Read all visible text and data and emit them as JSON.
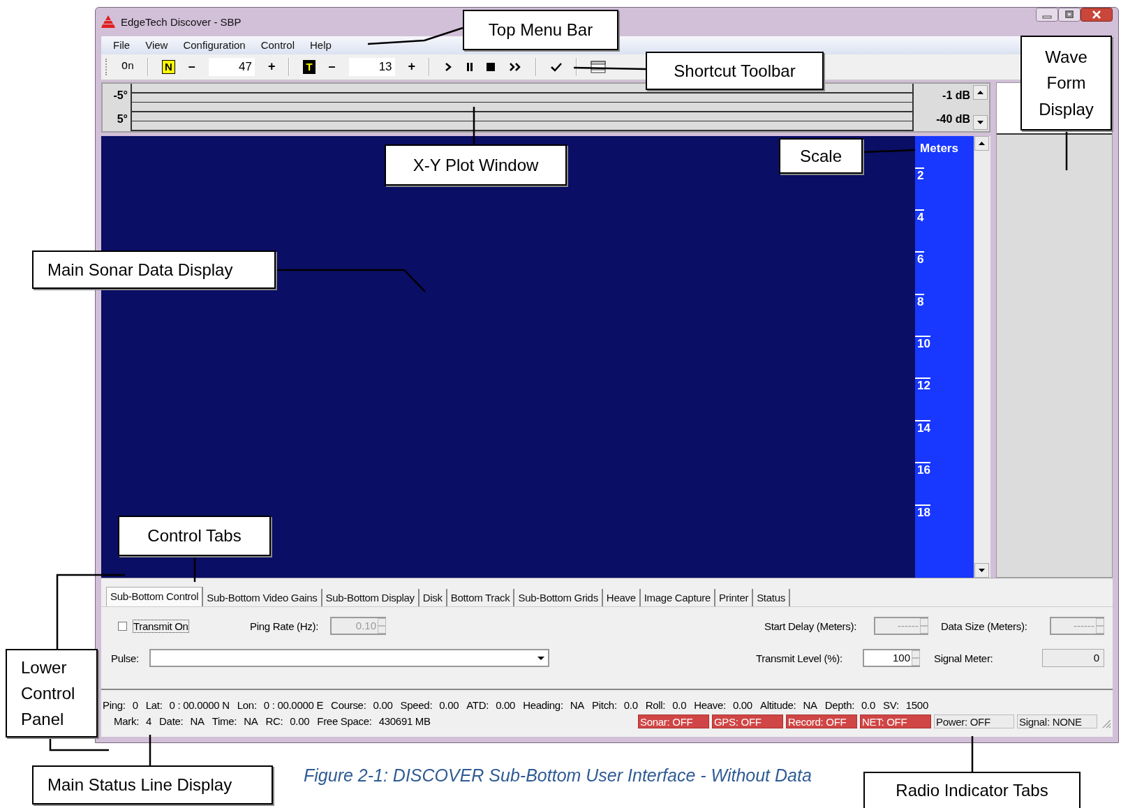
{
  "window": {
    "title": "EdgeTech  Discover - SBP"
  },
  "menu": [
    "File",
    "View",
    "Configuration",
    "Control",
    "Help"
  ],
  "toolbar": {
    "mode": "On",
    "gain_groups": [
      {
        "badge": "N",
        "inverted": false,
        "minus": "–",
        "value": "47",
        "plus": "+"
      },
      {
        "badge": "T",
        "inverted": true,
        "minus": "–",
        "value": "13",
        "plus": "+"
      }
    ]
  },
  "angle_scale": {
    "top": "-5°",
    "bottom": "5°"
  },
  "db_scale": {
    "top": "-1 dB",
    "bottom": "-40 dB"
  },
  "depth_scale": {
    "unit": "Meters",
    "ticks": [
      "2",
      "4",
      "6",
      "8",
      "10",
      "12",
      "14",
      "16",
      "18"
    ]
  },
  "tabs": [
    {
      "label": "Sub-Bottom Control",
      "selected": true
    },
    {
      "label": "Sub-Bottom Video Gains",
      "selected": false
    },
    {
      "label": "Sub-Bottom Display",
      "selected": false
    },
    {
      "label": "Disk",
      "selected": false
    },
    {
      "label": "Bottom Track",
      "selected": false
    },
    {
      "label": "Sub-Bottom Grids",
      "selected": false
    },
    {
      "label": "Heave",
      "selected": false
    },
    {
      "label": "Image Capture",
      "selected": false
    },
    {
      "label": "Printer",
      "selected": false
    },
    {
      "label": "Status",
      "selected": false
    }
  ],
  "controls": {
    "transmit": {
      "label": "Transmit On",
      "checked": false
    },
    "ping_rate": {
      "label": "Ping Rate (Hz):",
      "value": "0.10",
      "disabled": true
    },
    "start_delay": {
      "label": "Start Delay (Meters):",
      "value": "------",
      "disabled": true
    },
    "data_size": {
      "label": "Data Size (Meters):",
      "value": "------",
      "disabled": true
    },
    "pulse": {
      "label": "Pulse:"
    },
    "transmit_level": {
      "label": "Transmit Level (%):",
      "value": "100",
      "disabled": false
    },
    "signal_meter": {
      "label": "Signal Meter:",
      "value": "0"
    }
  },
  "status_line_1": [
    {
      "label": "Ping:",
      "value": "0"
    },
    {
      "label": "Lat:",
      "value": "0 : 00.0000 N"
    },
    {
      "label": "Lon:",
      "value": "0 : 00.0000 E"
    },
    {
      "label": "Course:",
      "value": "0.00"
    },
    {
      "label": "Speed:",
      "value": "0.00"
    },
    {
      "label": "ATD:",
      "value": "0.00"
    },
    {
      "label": "Heading:",
      "value": "NA"
    },
    {
      "label": "Pitch:",
      "value": "0.0"
    },
    {
      "label": "Roll:",
      "value": "0.0"
    },
    {
      "label": "Heave:",
      "value": "0.00"
    },
    {
      "label": "Altitude:",
      "value": "NA"
    },
    {
      "label": "Depth:",
      "value": "0.0"
    },
    {
      "label": "SV:",
      "value": "1500"
    }
  ],
  "status_line_2": [
    {
      "label": "Mark:",
      "value": "4"
    },
    {
      "label": "Date:",
      "value": "NA"
    },
    {
      "label": "Time:",
      "value": "NA"
    },
    {
      "label": "RC:",
      "value": "0.00"
    },
    {
      "label": "Free Space:",
      "value": "430691 MB"
    }
  ],
  "indicators": [
    {
      "text": "Sonar: OFF",
      "color": "#d04545"
    },
    {
      "text": "GPS: OFF",
      "color": "#d04545"
    },
    {
      "text": "Record: OFF",
      "color": "#d04545"
    },
    {
      "text": "NET: OFF",
      "color": "#d04545"
    },
    {
      "text": "Power: OFF",
      "color": "#ececec"
    },
    {
      "text": "Signal: NONE",
      "color": "#ececec"
    }
  ],
  "callouts": [
    {
      "text": "Top Menu Bar"
    },
    {
      "text": "Wave Form Display"
    },
    {
      "text": "Shortcut Toolbar"
    },
    {
      "text": "Scale"
    },
    {
      "text": "X-Y Plot Window"
    },
    {
      "text": "Main Sonar Data Display"
    },
    {
      "text": "Control Tabs"
    },
    {
      "text": "Lower Control Panel"
    },
    {
      "text": "Main Status Line Display"
    },
    {
      "text": "Radio Indicator Tabs"
    }
  ],
  "caption": "Figure 2-1: DISCOVER Sub-Bottom User Interface - Without Data"
}
